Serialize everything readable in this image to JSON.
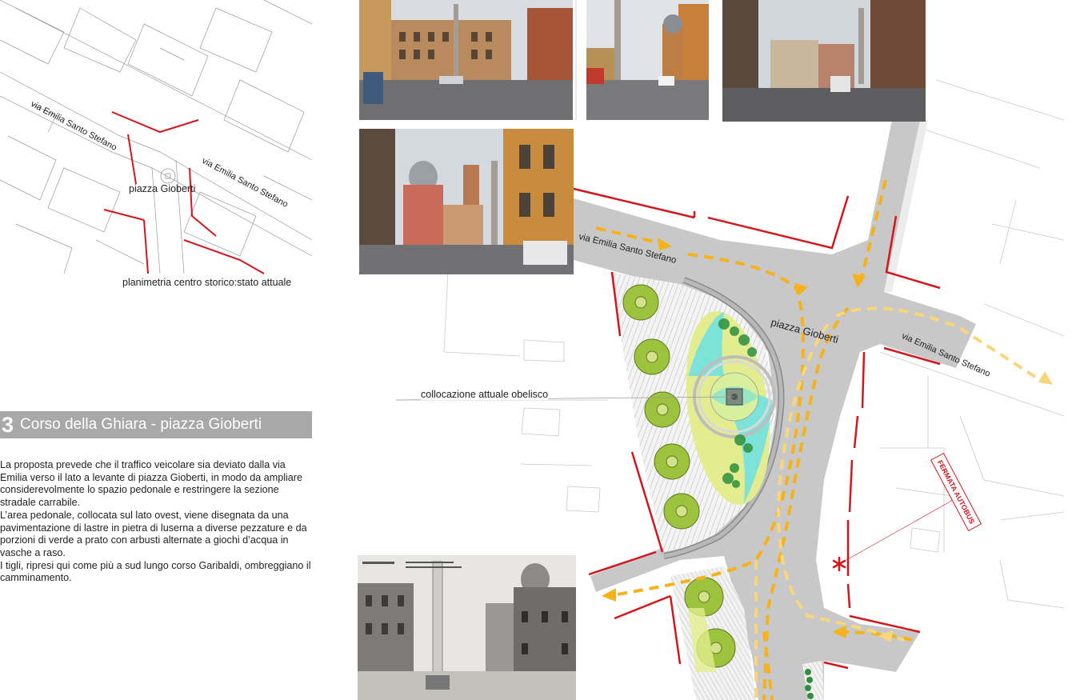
{
  "keymap": {
    "street_label_1": "via Emilia Santo Stefano",
    "street_label_2": "via Emilia Santo Stefano",
    "square_label": "piazza Gioberti",
    "caption": "planimetria centro storico:stato attuale"
  },
  "plan": {
    "street_label_nw": "via Emilia Santo Stefano",
    "street_label_e": "via Emilia Santo Stefano",
    "square_label": "piazza Gioberti",
    "obelisk_label": "collocazione attuale obelisco",
    "bus_stop_label": "FERMATA AUTOBUS",
    "colors": {
      "road": "#c8c8c8",
      "curb": "#d3171d",
      "traffic_arrow_primary": "#f5b21b",
      "traffic_arrow_secondary": "#f9d67a",
      "lawn": "#e3ed8f",
      "water": "#7de3d8",
      "tree": "#9cc23e",
      "paving_hatch": "#b4b4b4"
    }
  },
  "section": {
    "number": "3",
    "title": "Corso della Ghiara - piazza Gioberti"
  },
  "description": {
    "paragraphs": [
      "La proposta prevede che il traffico veicolare sia deviato dalla via Emilia verso il lato a levante di piazza Gioberti, in modo da ampliare considerevolmente lo spazio pedonale e restringere la sezione stradale carrabile.",
      "L’area pedonale, collocata sul lato ovest, viene disegnata da una pavimentazione di lastre in pietra di luserna a diverse pezzature e da porzioni di verde a  prato con arbusti alternate a giochi d’acqua in vasche a raso.",
      "I tigli, ripresi qui come più a sud lungo corso Garibaldi, ombreggiano il camminamento."
    ]
  },
  "photos": [
    {
      "name": "photo-piazza-view"
    },
    {
      "name": "photo-obelisk-dome"
    },
    {
      "name": "photo-via-emilia"
    },
    {
      "name": "photo-basilica-ghiara"
    },
    {
      "name": "historic-postcard"
    }
  ]
}
